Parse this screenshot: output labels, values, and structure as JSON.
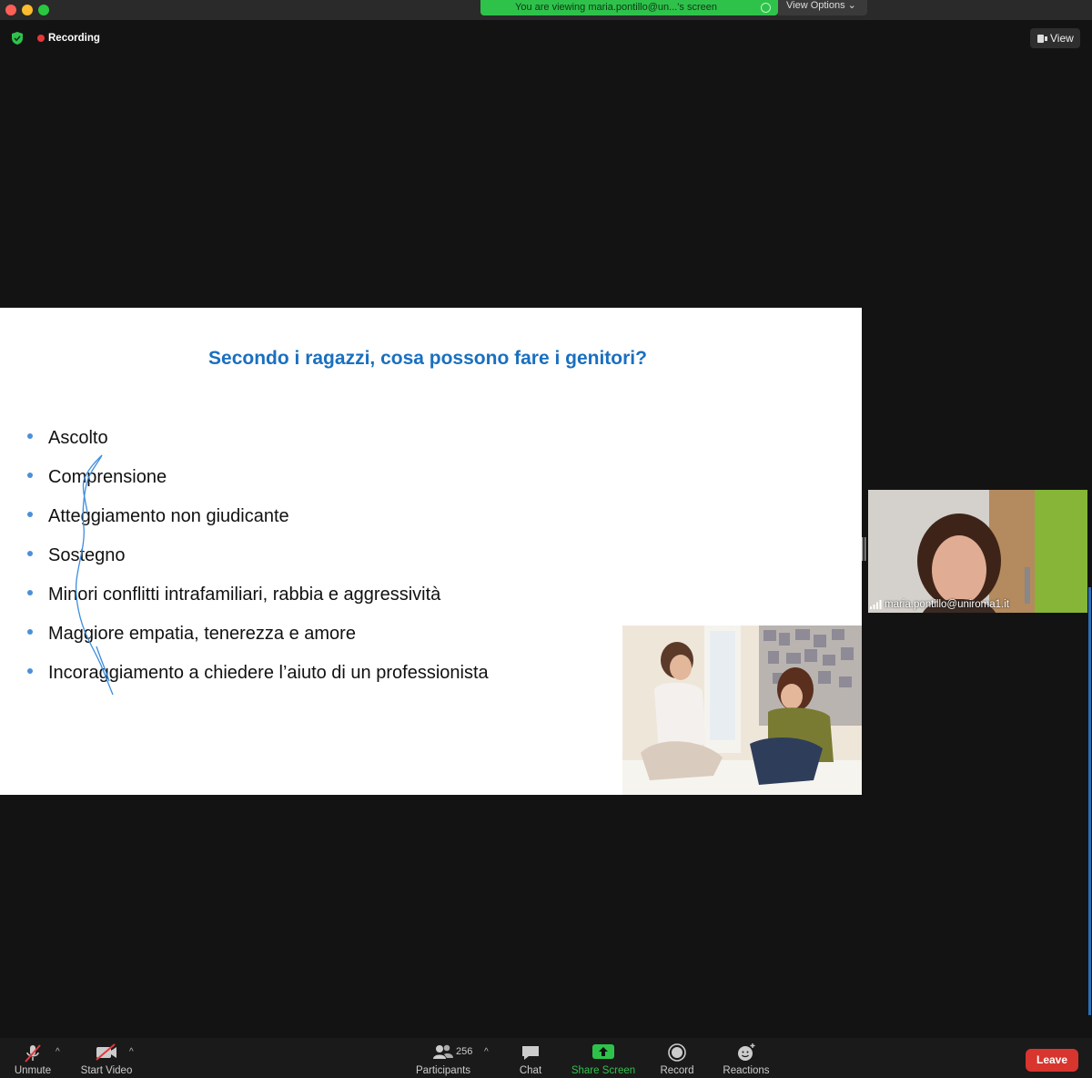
{
  "window": {
    "share_banner": "You are viewing maria.pontillo@un...'s screen",
    "view_options": "View Options",
    "recording_label": "Recording",
    "view_button": "View"
  },
  "slide": {
    "title": "Secondo i ragazzi, cosa possono fare i genitori?",
    "bullets": [
      "Ascolto",
      "Comprensione",
      "Atteggiamento non giudicante",
      "Sostegno",
      "Minori conflitti intrafamiliari, rabbia e aggressività",
      "Maggiore empatia, tenerezza e amore",
      "Incoraggiamento a chiedere l’aiuto di un professionista"
    ]
  },
  "participant_video": {
    "name": "maria.pontillo@uniroma1.it"
  },
  "toolbar": {
    "unmute": "Unmute",
    "start_video": "Start Video",
    "participants": "Participants",
    "participants_count": "256",
    "chat": "Chat",
    "share_screen": "Share Screen",
    "record": "Record",
    "reactions": "Reactions",
    "leave": "Leave"
  },
  "colors": {
    "banner_green": "#2fc24b",
    "title_blue": "#1a6fc0",
    "leave_red": "#d8352f",
    "share_green": "#2fc24b"
  }
}
